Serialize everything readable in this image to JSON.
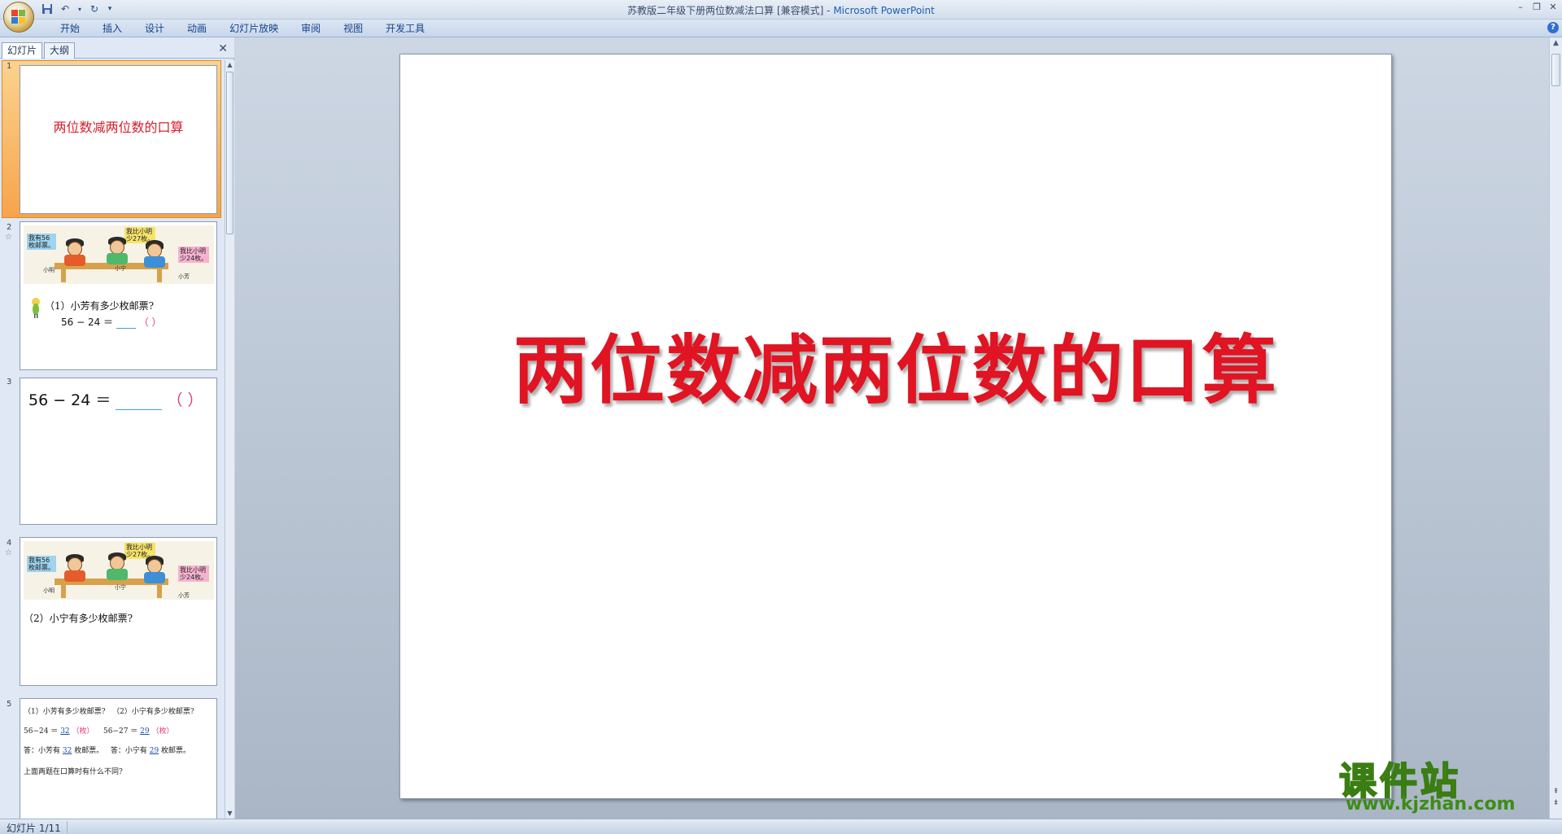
{
  "window": {
    "title": "苏教版二年级下册两位数减法口算 [兼容模式]",
    "app_name": "Microsoft PowerPoint"
  },
  "ribbon": {
    "tabs": [
      "开始",
      "插入",
      "设计",
      "动画",
      "幻灯片放映",
      "审阅",
      "视图",
      "开发工具"
    ]
  },
  "left_pane": {
    "tabs": [
      "幻灯片",
      "大纲"
    ],
    "thumbnails": [
      {
        "number": "1",
        "title": "两位数减两位数的口算"
      },
      {
        "number": "2",
        "bubble1": "我有56\n枚邮票。",
        "bubble2": "我比小明\n少27枚。",
        "bubble3": "我比小明\n少24枚。",
        "name1": "小明",
        "name2": "小宁",
        "name3": "小芳",
        "question": "（1）小芳有多少枚邮票?",
        "equation": "56 − 24 ＝",
        "paren": "（    ）"
      },
      {
        "number": "3",
        "equation": "56 − 24 ＝",
        "paren": "（    ）"
      },
      {
        "number": "4",
        "bubble1": "我有56\n枚邮票。",
        "bubble2": "我比小明\n少27枚。",
        "bubble3": "我比小明\n少24枚。",
        "name1": "小明",
        "name2": "小宁",
        "name3": "小芳",
        "question": "（2）小宁有多少枚邮票?"
      },
      {
        "number": "5",
        "line1a": "（1）小芳有多少枚邮票?",
        "line1b": "（2）小宁有多少枚邮票?",
        "line2a": "56−24 ＝",
        "ans2a": "32",
        "unit2a": "（枚）",
        "line2b": "56−27 ＝",
        "ans2b": "29",
        "unit2b": "（枚）",
        "line3a": "答：小芳有",
        "ans3a": "32",
        "tail3a": "枚邮票。",
        "line3b": "答：小宁有",
        "ans3b": "29",
        "tail3b": "枚邮票。",
        "line4": "上面两题在口算时有什么不同?"
      }
    ]
  },
  "slide": {
    "title": "两位数减两位数的口算"
  },
  "status": {
    "slide_indicator": "幻灯片 1/11"
  },
  "watermark": {
    "cn": "课件站",
    "url": "www.kjzhan.com"
  },
  "colors": {
    "title_red": "#e01422",
    "ribbon_blue": "#15428b",
    "watermark_yellow": "#f4e300",
    "watermark_green": "#3d8c15"
  }
}
